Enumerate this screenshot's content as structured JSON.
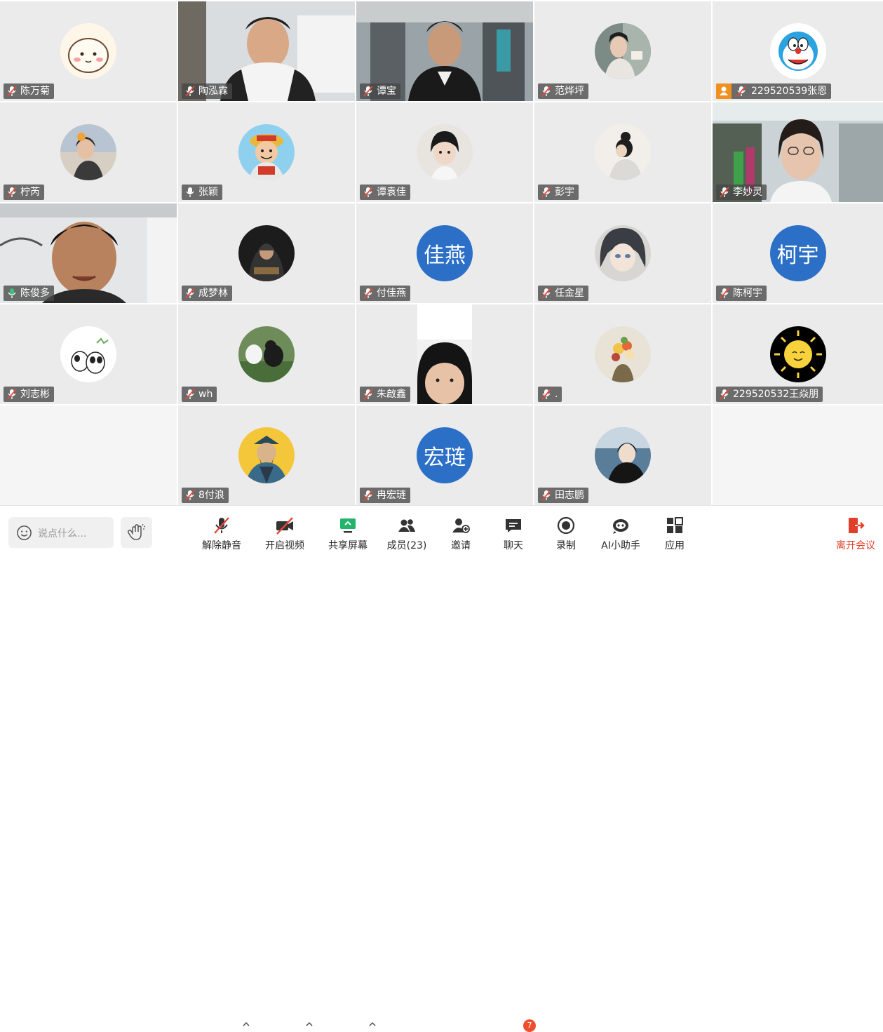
{
  "participants": [
    {
      "name": "陈万菊"
    },
    {
      "name": "陶泓霖"
    },
    {
      "name": "谭宝"
    },
    {
      "name": "范烨坪"
    },
    {
      "name": "229520539张恩"
    },
    {
      "name": "柠芮"
    },
    {
      "name": "张颖"
    },
    {
      "name": "谭袁佳"
    },
    {
      "name": "彭宇"
    },
    {
      "name": "李妙灵"
    },
    {
      "name": "陈俊多"
    },
    {
      "name": "成梦林"
    },
    {
      "name": "付佳燕",
      "avatar_text": "佳燕"
    },
    {
      "name": "任金星"
    },
    {
      "name": "陈柯宇",
      "avatar_text": "柯宇"
    },
    {
      "name": "刘志彬"
    },
    {
      "name": "wh"
    },
    {
      "name": "朱啟鑫"
    },
    {
      "name": "."
    },
    {
      "name": "229520532王焱朋"
    },
    {
      "name": "8付浪"
    },
    {
      "name": "冉宏琏",
      "avatar_text": "宏琏"
    },
    {
      "name": "田志鹏"
    }
  ],
  "toolbar": {
    "chat_placeholder": "说点什么...",
    "unmute": "解除静音",
    "start_video": "开启视频",
    "share_screen": "共享屏幕",
    "members": "成员(23)",
    "invite": "邀请",
    "chat": "聊天",
    "chat_badge": "7",
    "record": "录制",
    "ai_assistant": "AI小助手",
    "apps": "应用",
    "leave": "离开会议"
  },
  "colors": {
    "accent_green": "#3cc07a",
    "text_avatar_blue": "#2b6fc7",
    "leave_red": "#e0402a",
    "host_badge_orange": "#f0901e"
  }
}
